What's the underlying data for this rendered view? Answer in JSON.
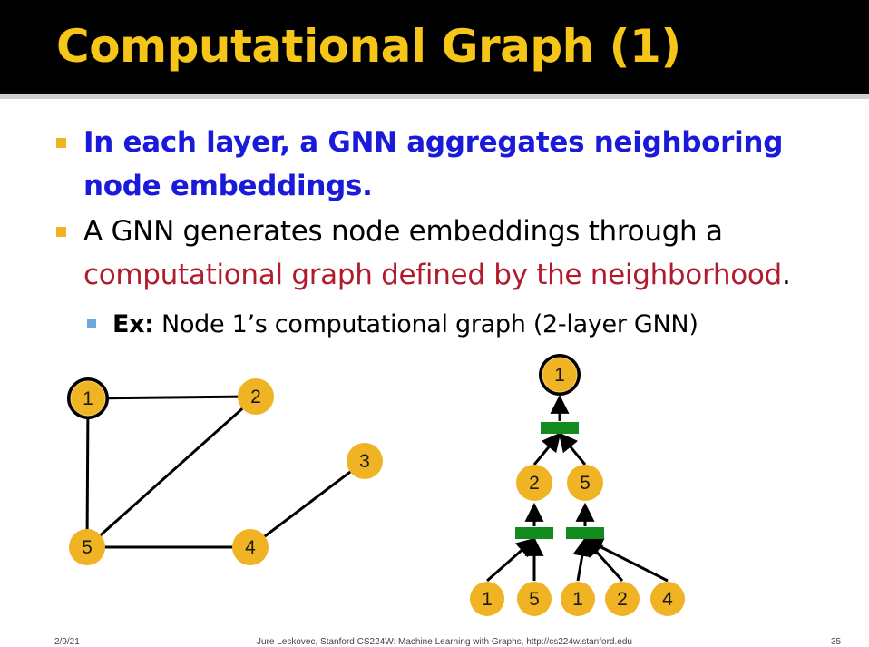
{
  "slide": {
    "title": "Computational Graph (1)",
    "bullets": [
      {
        "text": "In each layer, a GNN aggregates neighboring node embeddings."
      },
      {
        "text_before": "A GNN generates node embeddings through a ",
        "text_highlight": "computational graph defined by the neighborhood",
        "text_after": "."
      }
    ],
    "sub_bullet": {
      "label": "Ex:",
      "text": " Node 1’s computational graph (2-layer GNN)"
    },
    "colors": {
      "title": "#f5c518",
      "bullet_blue": "#1a1adb",
      "highlight_red": "#b01c2e",
      "node_fill": "#f0b323",
      "aggregator": "#138a1e"
    }
  },
  "input_graph": {
    "nodes": [
      "1",
      "2",
      "3",
      "4",
      "5"
    ],
    "edges": [
      [
        "1",
        "2"
      ],
      [
        "1",
        "5"
      ],
      [
        "2",
        "5"
      ],
      [
        "5",
        "4"
      ],
      [
        "4",
        "3"
      ]
    ],
    "target_node": "1"
  },
  "computation_graph": {
    "root": "1",
    "layer1": [
      "2",
      "5"
    ],
    "layer2": [
      [
        "1",
        "5"
      ],
      [
        "1",
        "2",
        "4"
      ]
    ]
  },
  "footer": {
    "date": "2/9/21",
    "credit": "Jure Leskovec, Stanford CS224W: Machine Learning with Graphs, http://cs224w.stanford.edu",
    "page": "35"
  }
}
